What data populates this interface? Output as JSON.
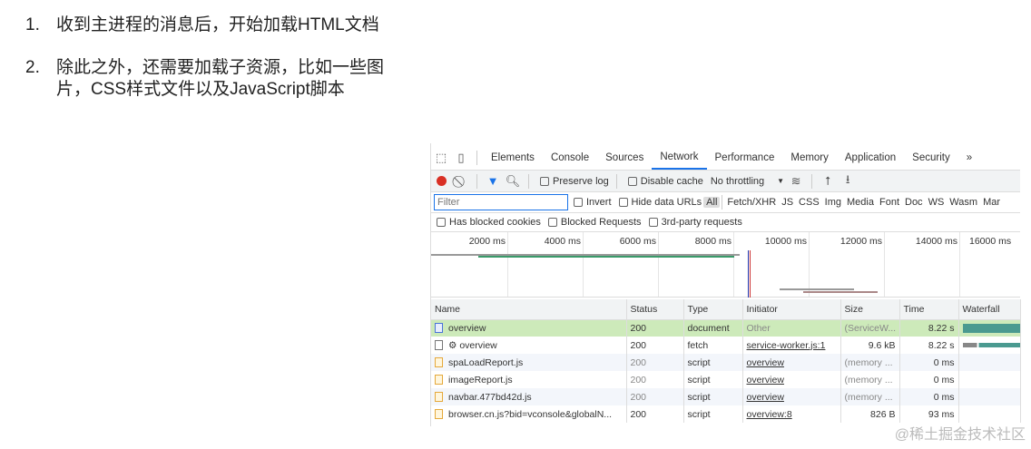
{
  "list": [
    {
      "num": "1.",
      "text": "收到主进程的消息后，开始加载HTML文档"
    },
    {
      "num": "2.",
      "text": "除此之外，还需要加载子资源，比如一些图片，CSS样式文件以及JavaScript脚本"
    }
  ],
  "devtools": {
    "tabs": [
      "Elements",
      "Console",
      "Sources",
      "Network",
      "Performance",
      "Memory",
      "Application",
      "Security",
      "»"
    ],
    "toolbar": {
      "preserve_log": "Preserve log",
      "disable_cache": "Disable cache",
      "throttling": "No throttling"
    },
    "filter": {
      "placeholder": "Filter",
      "invert": "Invert",
      "hide_data_urls": "Hide data URLs",
      "types": [
        "All",
        "Fetch/XHR",
        "JS",
        "CSS",
        "Img",
        "Media",
        "Font",
        "Doc",
        "WS",
        "Wasm",
        "Mar"
      ]
    },
    "checks": [
      "Has blocked cookies",
      "Blocked Requests",
      "3rd-party requests"
    ],
    "timeline_ticks": [
      "2000 ms",
      "4000 ms",
      "6000 ms",
      "8000 ms",
      "10000 ms",
      "12000 ms",
      "14000 ms",
      "16000 ms"
    ],
    "columns": [
      "Name",
      "Status",
      "Type",
      "Initiator",
      "Size",
      "Time",
      "Waterfall"
    ],
    "rows": [
      {
        "name": "overview",
        "status": "200",
        "type": "document",
        "initiator": "Other",
        "size": "(ServiceW...",
        "time": "8.22 s"
      },
      {
        "name": "⚙ overview",
        "status": "200",
        "type": "fetch",
        "initiator": "service-worker.js:1",
        "size": "9.6 kB",
        "time": "8.22 s"
      },
      {
        "name": "spaLoadReport.js",
        "status": "200",
        "type": "script",
        "initiator": "overview",
        "size": "(memory ...",
        "time": "0 ms"
      },
      {
        "name": "imageReport.js",
        "status": "200",
        "type": "script",
        "initiator": "overview",
        "size": "(memory ...",
        "time": "0 ms"
      },
      {
        "name": "navbar.477bd42d.js",
        "status": "200",
        "type": "script",
        "initiator": "overview",
        "size": "(memory ...",
        "time": "0 ms"
      },
      {
        "name": "browser.cn.js?bid=vconsole&globalN...",
        "status": "200",
        "type": "script",
        "initiator": "overview:8",
        "size": "826 B",
        "time": "93 ms"
      }
    ]
  },
  "watermark": "@稀土掘金技术社区"
}
